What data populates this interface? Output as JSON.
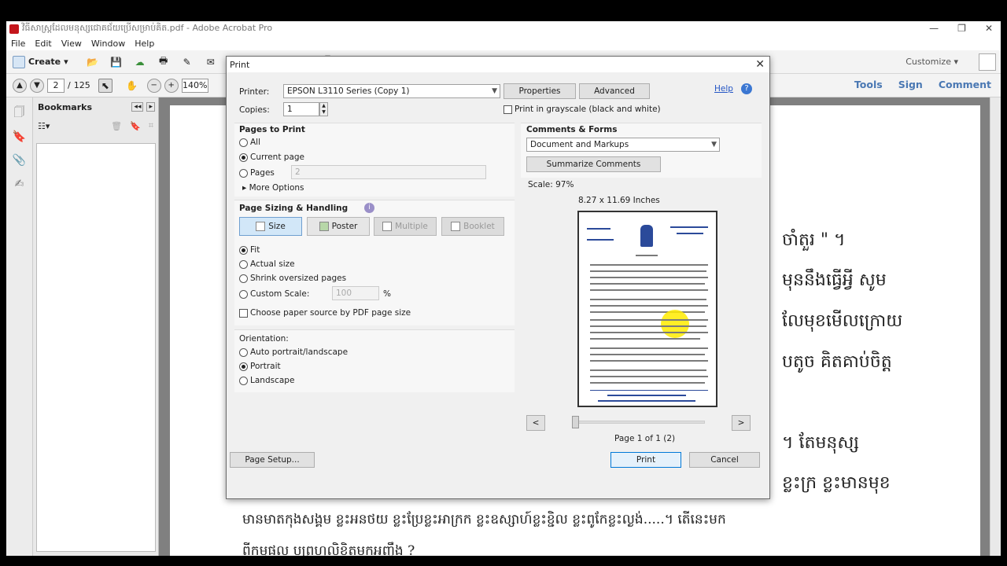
{
  "window": {
    "title": "វិធីសាស្ត្រដែលមនុស្សជោគជ័យប្រើសម្រាប់គិត.pdf - Adobe Acrobat Pro"
  },
  "menu": [
    "File",
    "Edit",
    "View",
    "Window",
    "Help"
  ],
  "toolbar": {
    "create_label": "Create",
    "customize_label": "Customize"
  },
  "nav": {
    "current_page": "2",
    "page_separator": "/",
    "total_pages": "125",
    "zoom": "140%",
    "links": [
      "Tools",
      "Sign",
      "Comment"
    ]
  },
  "sidebar": {
    "bookmarks_label": "Bookmarks"
  },
  "document_text": [
    "ចាំតួរ \" ។",
    "មុននឹងធ្វើអ្វី សូម",
    "លែមុខមើលក្រោយ",
    "បតូច គិតគាប់ចិត្ត",
    "។ តែមនុស្ស",
    "ខ្លះក្រ ខ្លះមានមុខ",
    "មានមាតកុងសង្គម ខ្លះអនថយ ខ្លះប្រែខ្លះអាក្រក ខ្លះឧស្សាហ៍ខ្លះខ្ជិល ខ្លះពូកែខ្លះល្ងង់.....។ តើនេះមក",
    "ពីកម្មផល ឬព្រហ្មលិខិតមកអញ្ចឹង ?"
  ],
  "print_dialog": {
    "title": "Print",
    "printer_label": "Printer:",
    "printer_value": "EPSON L3110 Series (Copy 1)",
    "properties_label": "Properties",
    "advanced_label": "Advanced",
    "help_label": "Help",
    "copies_label": "Copies:",
    "copies_value": "1",
    "grayscale_label": "Print in grayscale (black and white)",
    "pages_to_print": {
      "heading": "Pages to Print",
      "all": "All",
      "current": "Current page",
      "pages": "Pages",
      "pages_value": "2",
      "more_options": "More Options"
    },
    "sizing": {
      "heading": "Page Sizing & Handling",
      "size": "Size",
      "poster": "Poster",
      "multiple": "Multiple",
      "booklet": "Booklet",
      "fit": "Fit",
      "actual": "Actual size",
      "shrink": "Shrink oversized pages",
      "custom": "Custom Scale:",
      "custom_value": "100",
      "percent": "%",
      "paper_source": "Choose paper source by PDF page size"
    },
    "orientation": {
      "heading": "Orientation:",
      "auto": "Auto portrait/landscape",
      "portrait": "Portrait",
      "landscape": "Landscape"
    },
    "comments": {
      "heading": "Comments & Forms",
      "value": "Document and Markups",
      "summarize": "Summarize Comments"
    },
    "scale_label": "Scale:  97%",
    "paper_size": "8.27 x 11.69 Inches",
    "page_indicator": "Page 1 of 1 (2)",
    "prev": "<",
    "next": ">",
    "page_setup": "Page Setup...",
    "print_btn": "Print",
    "cancel_btn": "Cancel"
  }
}
